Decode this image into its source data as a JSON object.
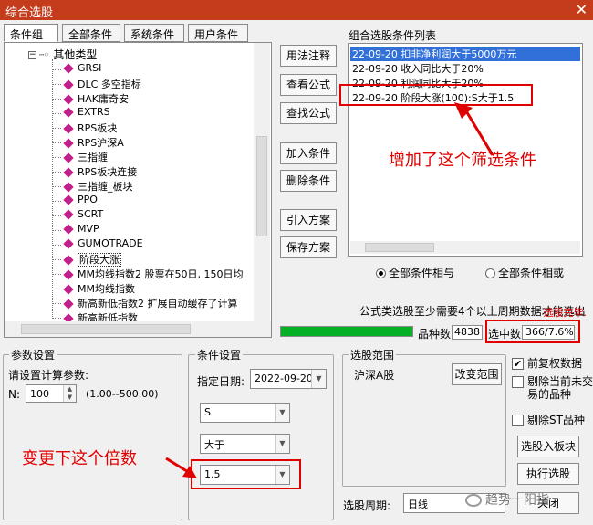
{
  "window": {
    "title": "综合选股",
    "close": "✕"
  },
  "tabs": [
    "条件组",
    "全部条件",
    "系统条件",
    "用户条件"
  ],
  "tree": {
    "root": "其他类型",
    "items": [
      "GRSI",
      "DLC 多空指标",
      "HAK庸奇安",
      "EXTRS",
      "RPS板块",
      "RPS沪深A",
      "三指缠",
      "RPS板块连接",
      "三指缠_板块",
      "PPO",
      "SCRT",
      "MVP",
      "GUMOTRADE",
      "阶段大涨",
      "MM均线指数2 股票在50日, 150日均",
      "MM均线指数",
      "新高新低指数2 扩展自动缓存了计算",
      "新高新低指数"
    ]
  },
  "mid_buttons": [
    "用法注释",
    "查看公式",
    "查找公式",
    "加入条件",
    "删除条件",
    "引入方案",
    "保存方案"
  ],
  "cond_list": {
    "title": "组合选股条件列表",
    "items": [
      "22-09-20 扣非净利润大于5000万元",
      "22-09-20 收入同比大于20%",
      "22-09-20 利润同比大于20%",
      "22-09-20 阶段大涨(100):S大于1.5"
    ]
  },
  "annotations": {
    "added": "增加了这个筛选条件",
    "multiplier": "变更下这个倍数"
  },
  "logic": {
    "and_label": "全部条件相与",
    "or_label": "全部条件相或",
    "selected": "and"
  },
  "status": {
    "hint": "公式类选股至少需要4个以上周期数据才能选出",
    "done": "选股完毕.",
    "count_label": "品种数",
    "count_value": "4838",
    "selected_label": "选中数",
    "selected_value": "366/7.6%",
    "progress": 1.0
  },
  "params": {
    "title": "参数设置",
    "prompt": "请设置计算参数:",
    "n_label": "N:",
    "n_value": "100",
    "range": "(1.00--500.00)"
  },
  "cond_settings": {
    "title": "条件设置",
    "date_label": "指定日期:",
    "date_value": "2022-09-20",
    "field": "S",
    "op": "大于",
    "value": "1.5"
  },
  "scope": {
    "title": "选股范围",
    "value": "沪深A股",
    "change_button": "改变范围",
    "period_label": "选股周期:",
    "period_value": "日线"
  },
  "options": {
    "adjust": {
      "label": "前复权数据",
      "checked": true
    },
    "exclude_untraded": {
      "label": "剔除当前未交易的品种",
      "checked": false
    },
    "exclude_st": {
      "label": "剔除ST品种",
      "checked": false
    }
  },
  "action_buttons": {
    "to_sector": "选股入板块",
    "run": "执行选股",
    "close": "关闭"
  },
  "watermark": "趋势一阳指"
}
